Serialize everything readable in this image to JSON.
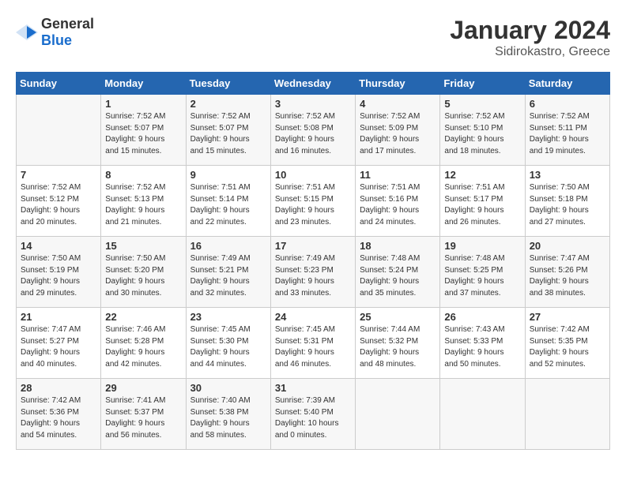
{
  "header": {
    "logo_general": "General",
    "logo_blue": "Blue",
    "title": "January 2024",
    "subtitle": "Sidirokastro, Greece"
  },
  "calendar": {
    "days_of_week": [
      "Sunday",
      "Monday",
      "Tuesday",
      "Wednesday",
      "Thursday",
      "Friday",
      "Saturday"
    ],
    "weeks": [
      [
        {
          "day": "",
          "info": ""
        },
        {
          "day": "1",
          "info": "Sunrise: 7:52 AM\nSunset: 5:07 PM\nDaylight: 9 hours\nand 15 minutes."
        },
        {
          "day": "2",
          "info": "Sunrise: 7:52 AM\nSunset: 5:07 PM\nDaylight: 9 hours\nand 15 minutes."
        },
        {
          "day": "3",
          "info": "Sunrise: 7:52 AM\nSunset: 5:08 PM\nDaylight: 9 hours\nand 16 minutes."
        },
        {
          "day": "4",
          "info": "Sunrise: 7:52 AM\nSunset: 5:09 PM\nDaylight: 9 hours\nand 17 minutes."
        },
        {
          "day": "5",
          "info": "Sunrise: 7:52 AM\nSunset: 5:10 PM\nDaylight: 9 hours\nand 18 minutes."
        },
        {
          "day": "6",
          "info": "Sunrise: 7:52 AM\nSunset: 5:11 PM\nDaylight: 9 hours\nand 19 minutes."
        }
      ],
      [
        {
          "day": "7",
          "info": "Sunrise: 7:52 AM\nSunset: 5:12 PM\nDaylight: 9 hours\nand 20 minutes."
        },
        {
          "day": "8",
          "info": "Sunrise: 7:52 AM\nSunset: 5:13 PM\nDaylight: 9 hours\nand 21 minutes."
        },
        {
          "day": "9",
          "info": "Sunrise: 7:51 AM\nSunset: 5:14 PM\nDaylight: 9 hours\nand 22 minutes."
        },
        {
          "day": "10",
          "info": "Sunrise: 7:51 AM\nSunset: 5:15 PM\nDaylight: 9 hours\nand 23 minutes."
        },
        {
          "day": "11",
          "info": "Sunrise: 7:51 AM\nSunset: 5:16 PM\nDaylight: 9 hours\nand 24 minutes."
        },
        {
          "day": "12",
          "info": "Sunrise: 7:51 AM\nSunset: 5:17 PM\nDaylight: 9 hours\nand 26 minutes."
        },
        {
          "day": "13",
          "info": "Sunrise: 7:50 AM\nSunset: 5:18 PM\nDaylight: 9 hours\nand 27 minutes."
        }
      ],
      [
        {
          "day": "14",
          "info": "Sunrise: 7:50 AM\nSunset: 5:19 PM\nDaylight: 9 hours\nand 29 minutes."
        },
        {
          "day": "15",
          "info": "Sunrise: 7:50 AM\nSunset: 5:20 PM\nDaylight: 9 hours\nand 30 minutes."
        },
        {
          "day": "16",
          "info": "Sunrise: 7:49 AM\nSunset: 5:21 PM\nDaylight: 9 hours\nand 32 minutes."
        },
        {
          "day": "17",
          "info": "Sunrise: 7:49 AM\nSunset: 5:23 PM\nDaylight: 9 hours\nand 33 minutes."
        },
        {
          "day": "18",
          "info": "Sunrise: 7:48 AM\nSunset: 5:24 PM\nDaylight: 9 hours\nand 35 minutes."
        },
        {
          "day": "19",
          "info": "Sunrise: 7:48 AM\nSunset: 5:25 PM\nDaylight: 9 hours\nand 37 minutes."
        },
        {
          "day": "20",
          "info": "Sunrise: 7:47 AM\nSunset: 5:26 PM\nDaylight: 9 hours\nand 38 minutes."
        }
      ],
      [
        {
          "day": "21",
          "info": "Sunrise: 7:47 AM\nSunset: 5:27 PM\nDaylight: 9 hours\nand 40 minutes."
        },
        {
          "day": "22",
          "info": "Sunrise: 7:46 AM\nSunset: 5:28 PM\nDaylight: 9 hours\nand 42 minutes."
        },
        {
          "day": "23",
          "info": "Sunrise: 7:45 AM\nSunset: 5:30 PM\nDaylight: 9 hours\nand 44 minutes."
        },
        {
          "day": "24",
          "info": "Sunrise: 7:45 AM\nSunset: 5:31 PM\nDaylight: 9 hours\nand 46 minutes."
        },
        {
          "day": "25",
          "info": "Sunrise: 7:44 AM\nSunset: 5:32 PM\nDaylight: 9 hours\nand 48 minutes."
        },
        {
          "day": "26",
          "info": "Sunrise: 7:43 AM\nSunset: 5:33 PM\nDaylight: 9 hours\nand 50 minutes."
        },
        {
          "day": "27",
          "info": "Sunrise: 7:42 AM\nSunset: 5:35 PM\nDaylight: 9 hours\nand 52 minutes."
        }
      ],
      [
        {
          "day": "28",
          "info": "Sunrise: 7:42 AM\nSunset: 5:36 PM\nDaylight: 9 hours\nand 54 minutes."
        },
        {
          "day": "29",
          "info": "Sunrise: 7:41 AM\nSunset: 5:37 PM\nDaylight: 9 hours\nand 56 minutes."
        },
        {
          "day": "30",
          "info": "Sunrise: 7:40 AM\nSunset: 5:38 PM\nDaylight: 9 hours\nand 58 minutes."
        },
        {
          "day": "31",
          "info": "Sunrise: 7:39 AM\nSunset: 5:40 PM\nDaylight: 10 hours\nand 0 minutes."
        },
        {
          "day": "",
          "info": ""
        },
        {
          "day": "",
          "info": ""
        },
        {
          "day": "",
          "info": ""
        }
      ]
    ]
  }
}
